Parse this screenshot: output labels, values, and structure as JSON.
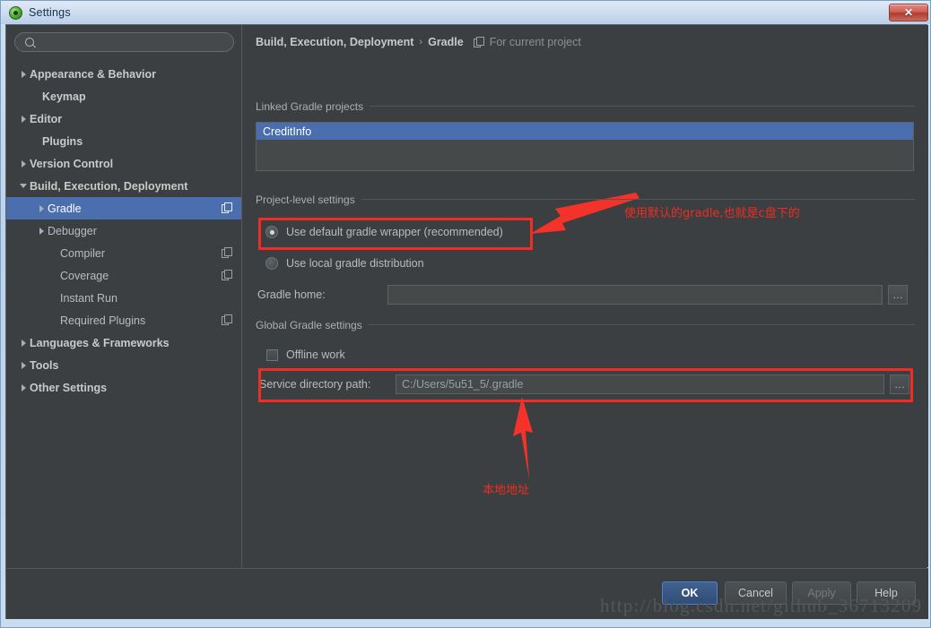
{
  "window": {
    "title": "Settings",
    "app_icon": "android-studio-icon",
    "close_label": "✕"
  },
  "sidebar": {
    "search": {
      "value": "",
      "placeholder": "",
      "icon": "search-icon"
    },
    "items": [
      {
        "label": "Appearance & Behavior",
        "indent": 12,
        "twisty": "right",
        "bold": true,
        "selected": false,
        "project_icon": false
      },
      {
        "label": "Keymap",
        "indent": 26,
        "twisty": "none",
        "bold": true,
        "selected": false,
        "project_icon": false
      },
      {
        "label": "Editor",
        "indent": 12,
        "twisty": "right",
        "bold": true,
        "selected": false,
        "project_icon": false
      },
      {
        "label": "Plugins",
        "indent": 26,
        "twisty": "none",
        "bold": true,
        "selected": false,
        "project_icon": false
      },
      {
        "label": "Version Control",
        "indent": 12,
        "twisty": "right",
        "bold": true,
        "selected": false,
        "project_icon": false
      },
      {
        "label": "Build, Execution, Deployment",
        "indent": 12,
        "twisty": "down",
        "bold": true,
        "selected": false,
        "project_icon": false
      },
      {
        "label": "Gradle",
        "indent": 32,
        "twisty": "right",
        "bold": false,
        "selected": true,
        "project_icon": true
      },
      {
        "label": "Debugger",
        "indent": 32,
        "twisty": "right",
        "bold": false,
        "selected": false,
        "project_icon": false
      },
      {
        "label": "Compiler",
        "indent": 46,
        "twisty": "none",
        "bold": false,
        "selected": false,
        "project_icon": true
      },
      {
        "label": "Coverage",
        "indent": 46,
        "twisty": "none",
        "bold": false,
        "selected": false,
        "project_icon": true
      },
      {
        "label": "Instant Run",
        "indent": 46,
        "twisty": "none",
        "bold": false,
        "selected": false,
        "project_icon": false
      },
      {
        "label": "Required Plugins",
        "indent": 46,
        "twisty": "none",
        "bold": false,
        "selected": false,
        "project_icon": true
      },
      {
        "label": "Languages & Frameworks",
        "indent": 12,
        "twisty": "right",
        "bold": true,
        "selected": false,
        "project_icon": false
      },
      {
        "label": "Tools",
        "indent": 12,
        "twisty": "right",
        "bold": true,
        "selected": false,
        "project_icon": false
      },
      {
        "label": "Other Settings",
        "indent": 12,
        "twisty": "right",
        "bold": true,
        "selected": false,
        "project_icon": false
      }
    ]
  },
  "content": {
    "breadcrumb": {
      "parent": "Build, Execution, Deployment",
      "separator": "›",
      "leaf": "Gradle",
      "scope_icon": "project-scope-icon",
      "scope_note": "For current project"
    },
    "linked_projects": {
      "group_title": "Linked Gradle projects",
      "items": [
        "CreditInfo"
      ]
    },
    "project_level": {
      "group_title": "Project-level settings",
      "radio_default_wrapper": "Use default gradle wrapper (recommended)",
      "radio_local_distribution": "Use local gradle distribution",
      "selected_radio": "default_wrapper",
      "gradle_home_label": "Gradle home:",
      "gradle_home_value": "",
      "browse_label": "…"
    },
    "global_settings": {
      "group_title": "Global Gradle settings",
      "offline_work_label": "Offline work",
      "offline_work_checked": false,
      "service_dir_label": "Service directory path:",
      "service_dir_value": "C:/Users/5u51_5/.gradle",
      "browse_label": "…"
    }
  },
  "annotations": {
    "color": "#ef2c22",
    "note_top": "使用默认的gradle,也就是c盘下的",
    "note_bottom": "本地地址"
  },
  "buttons": {
    "ok": "OK",
    "cancel": "Cancel",
    "apply": "Apply",
    "help": "Help"
  },
  "watermark": "http://blog.csdn.net/github_36713209"
}
